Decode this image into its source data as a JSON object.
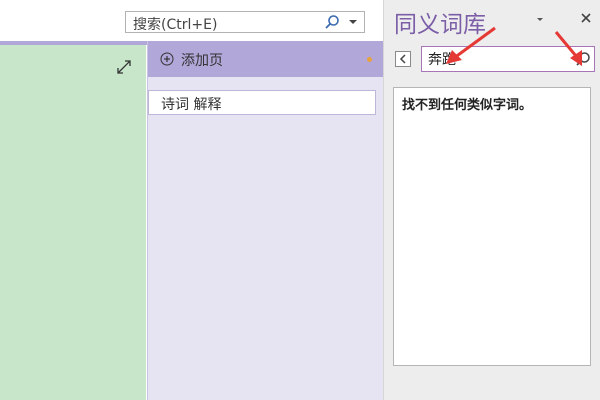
{
  "search": {
    "placeholder": "搜索(Ctrl+E)"
  },
  "pages": {
    "add_page_label": "添加页",
    "items": [
      {
        "label": "诗词 解释"
      }
    ]
  },
  "thesaurus": {
    "title": "同义词库",
    "query_value": "奔跑",
    "empty_message": "找不到任何类似字词。"
  },
  "colors": {
    "accent_purple": "#7b5ea7",
    "band_purple": "#b1a7d9",
    "page_green": "#c8e6c9",
    "annotation_red": "#e53935"
  },
  "icons": [
    "search-icon",
    "dropdown-caret-icon",
    "expand-icon",
    "add-page-icon",
    "pane-menu-icon",
    "close-icon",
    "back-icon",
    "thesaurus-search-icon",
    "red-arrow-annotation"
  ]
}
